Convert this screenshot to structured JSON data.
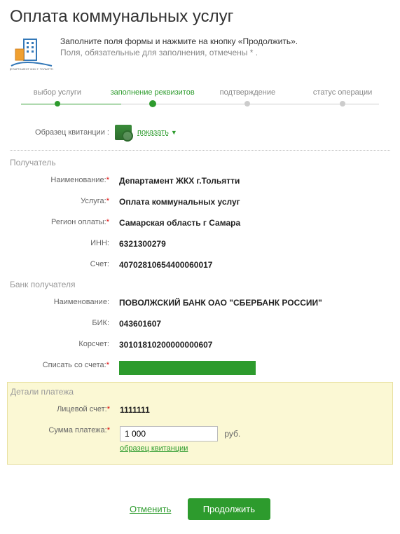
{
  "title": "Оплата коммунальных услуг",
  "header": {
    "line1": "Заполните поля формы и нажмите на кнопку «Продолжить».",
    "line2": "Поля, обязательные для заполнения, отмечены * ."
  },
  "steps": [
    "выбор услуги",
    "заполнение реквизитов",
    "подтверждение",
    "статус операции"
  ],
  "sample": {
    "label": "Образец квитанции :",
    "link": "показать"
  },
  "recipient": {
    "title": "Получатель",
    "name_label": "Наименование:",
    "name": "Департамент ЖКХ г.Тольятти",
    "service_label": "Услуга:",
    "service": "Оплата коммунальных услуг",
    "region_label": "Регион оплаты:",
    "region": "Самарская область г Самара",
    "inn_label": "ИНН:",
    "inn": "6321300279",
    "account_label": "Счет:",
    "account": "40702810654400060017"
  },
  "bank": {
    "title": "Банк получателя",
    "name_label": "Наименование:",
    "name": "ПОВОЛЖСКИЙ БАНК ОАО \"СБЕРБАНК РОССИИ\"",
    "bik_label": "БИК:",
    "bik": "043601607",
    "kor_label": "Корсчет:",
    "kor": "30101810200000000607",
    "debit_label": "Списать со счета:"
  },
  "details": {
    "title": "Детали платежа",
    "acc_label": "Лицевой счет:",
    "acc": "1111111",
    "sum_label": "Сумма платежа:",
    "sum_value": "1 000",
    "currency": "руб.",
    "sample_link": "образец квитанции"
  },
  "actions": {
    "cancel": "Отменить",
    "continue": "Продолжить"
  }
}
